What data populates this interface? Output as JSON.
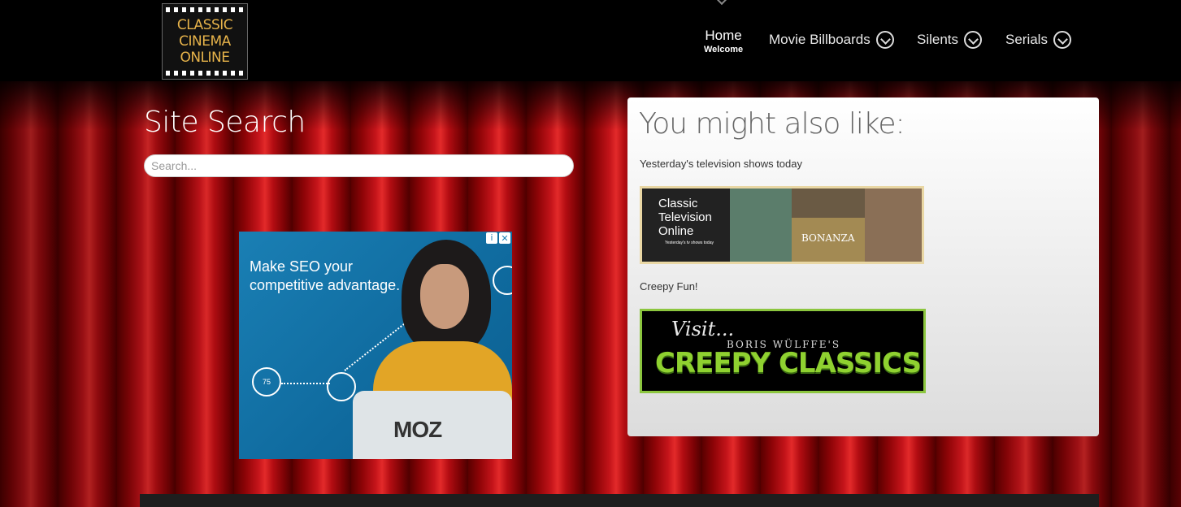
{
  "logo": {
    "line1": "CLASSIC",
    "line2": "CINEMA",
    "line3": "ONLINE"
  },
  "nav": {
    "home": {
      "label": "Home",
      "sub": "Welcome"
    },
    "items": [
      {
        "label": "Movie Billboards",
        "icon": "chevron-down-circle-icon"
      },
      {
        "label": "Silents",
        "icon": "chevron-down-circle-icon"
      },
      {
        "label": "Serials",
        "icon": "chevron-down-circle-icon"
      }
    ]
  },
  "search": {
    "title": "Site Search",
    "placeholder": "Search...",
    "value": ""
  },
  "ad": {
    "headline_line1": "Make SEO your",
    "headline_line2": "competitive advantage.",
    "brand": "MOZ",
    "badge": "75",
    "adchoices_info": "i",
    "adchoices_close": "✕"
  },
  "related": {
    "title": "You might also like:",
    "items": [
      {
        "caption": "Yesterday's television shows today",
        "banner_title_1": "Classic",
        "banner_title_2": "Television",
        "banner_title_3": "Online",
        "banner_sub": "Yesterday's tv shows today",
        "banner_show": "BONANZA"
      },
      {
        "caption": "Creepy Fun!",
        "banner_visit": "Visit...",
        "banner_author": "BORIS WÜLFFE'S",
        "banner_title": "CREEPY CLASSICS"
      }
    ]
  },
  "colors": {
    "background": "#000000",
    "curtain": "#c4141a",
    "logo_text": "#e7b34a",
    "panel": "#ffffff",
    "creepy_green": "#8fd130"
  }
}
